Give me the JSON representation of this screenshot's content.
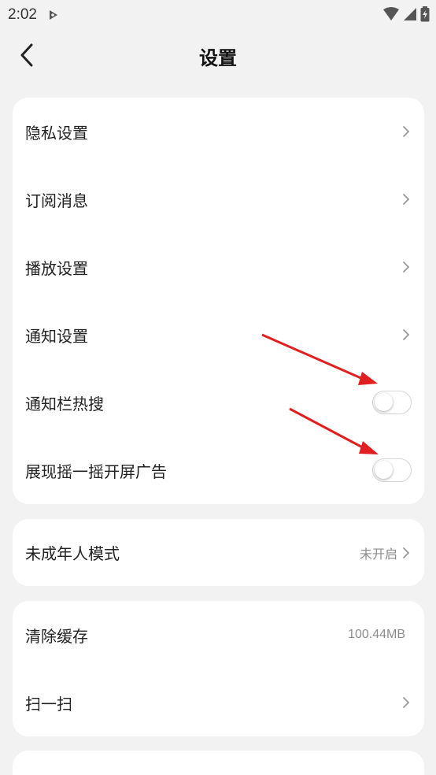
{
  "status_bar": {
    "time": "2:02"
  },
  "header": {
    "title": "设置"
  },
  "card1": {
    "items": [
      {
        "label": "隐私设置"
      },
      {
        "label": "订阅消息"
      },
      {
        "label": "播放设置"
      },
      {
        "label": "通知设置"
      }
    ],
    "toggles": [
      {
        "label": "通知栏热搜",
        "on": false
      },
      {
        "label": "展现摇一摇开屏广告",
        "on": false
      }
    ]
  },
  "card2": {
    "label": "未成年人模式",
    "value": "未开启"
  },
  "card3": {
    "cache_label": "清除缓存",
    "cache_value": "100.44MB",
    "scan_label": "扫一扫"
  },
  "colors": {
    "annotation_arrow": "#e02020",
    "background": "#f2f2f2"
  }
}
